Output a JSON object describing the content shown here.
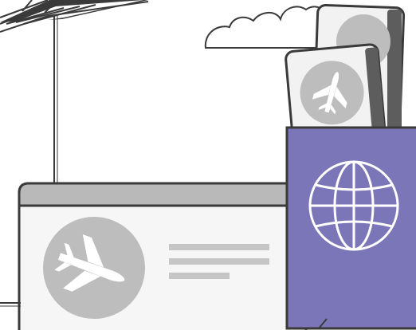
{
  "colors": {
    "background": "#ffffff",
    "outline": "#3a3a3a",
    "ticket_header": "#b9b9b9",
    "ticket_body": "#f6f6f6",
    "badge_circle": "#bdbdbd",
    "text_lines": "#c6c6c6",
    "passport_cover": "#7b76b8",
    "passport_spine": "#5d5d5d",
    "card_face": "#f2f2f2",
    "cloud_fill": "#ffffff"
  },
  "icons": {
    "ticket_badge": "airplane-icon",
    "card_badge": "airplane-icon",
    "passport_emblem": "globe-icon"
  }
}
